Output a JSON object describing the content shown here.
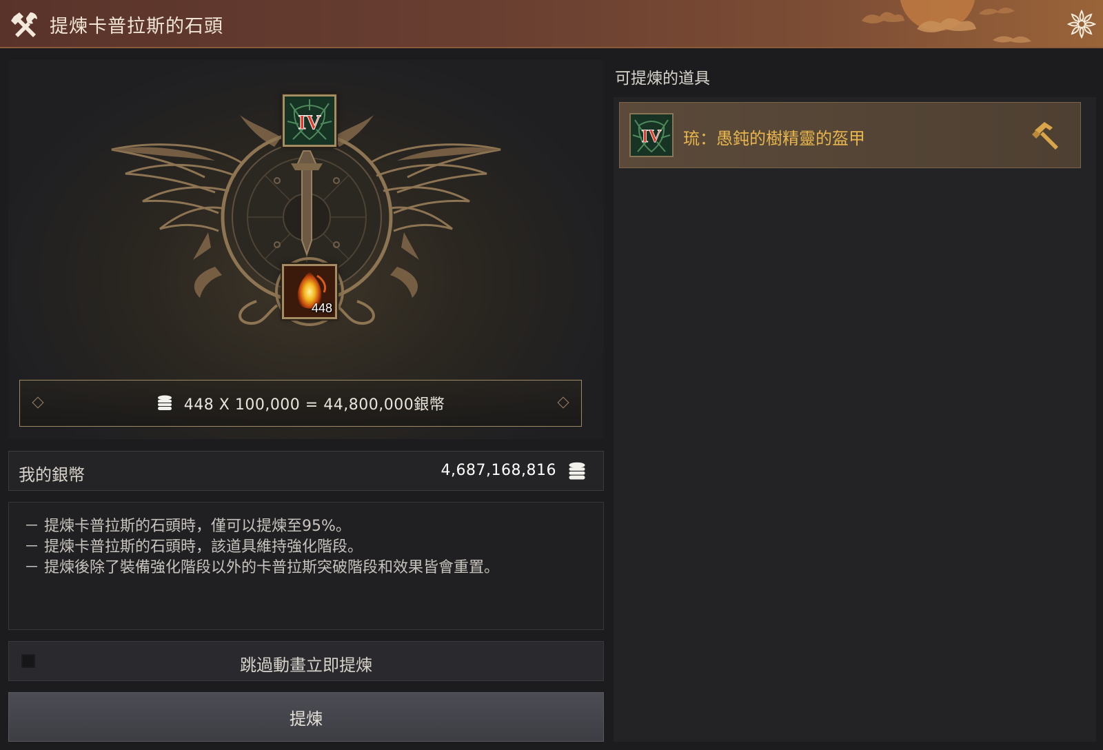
{
  "window": {
    "title": "提煉卡普拉斯的石頭",
    "icon": "tools-icon",
    "close_icon": "flower-close-icon"
  },
  "emblem": {
    "equipment_tier": "IV",
    "stone_count": "448"
  },
  "cost": {
    "formula": "448 X 100,000 = 44,800,000銀幣",
    "icon": "silver-coin-icon"
  },
  "my_silver": {
    "label": "我的銀幣",
    "value": "4,687,168,816"
  },
  "notes": [
    "－ 提煉卡普拉斯的石頭時，僅可以提煉至95%。",
    "－ 提煉卡普拉斯的石頭時，該道具維持強化階段。",
    "－ 提煉後除了裝備強化階段以外的卡普拉斯突破階段和效果皆會重置。"
  ],
  "skip_animation": {
    "label": "跳過動畫立即提煉",
    "checked": false
  },
  "refine_button": {
    "label": "提煉"
  },
  "refinable": {
    "title": "可提煉的道具",
    "items": [
      {
        "tier": "IV",
        "name": "琉：愚鈍的樹精靈的盔甲",
        "action_icon": "hammer-icon"
      }
    ]
  },
  "colors": {
    "accent_gold": "#e8b64c",
    "tier_red": "#e23a2a",
    "frame_gold": "#a58c63"
  }
}
